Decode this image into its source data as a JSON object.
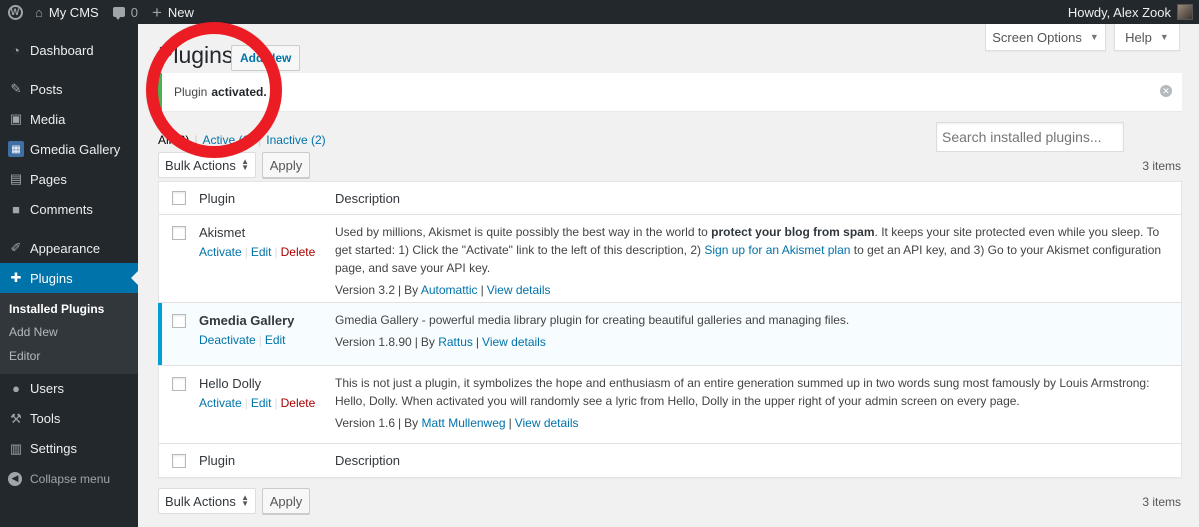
{
  "adminbar": {
    "site_name": "My CMS",
    "comment_count": "0",
    "new_label": "New",
    "greeting": "Howdy, Alex Zook"
  },
  "sidebar": {
    "items": [
      {
        "label": "Dashboard",
        "icon": "dashboard-icon"
      },
      {
        "label": "Posts",
        "icon": "pin-icon"
      },
      {
        "label": "Media",
        "icon": "media-icon"
      },
      {
        "label": "Gmedia Gallery",
        "icon": "gallery-icon"
      },
      {
        "label": "Pages",
        "icon": "pages-icon"
      },
      {
        "label": "Comments",
        "icon": "comment-icon"
      },
      {
        "label": "Appearance",
        "icon": "brush-icon"
      },
      {
        "label": "Plugins",
        "icon": "plugin-icon"
      },
      {
        "label": "Users",
        "icon": "users-icon"
      },
      {
        "label": "Tools",
        "icon": "wrench-icon"
      },
      {
        "label": "Settings",
        "icon": "settings-icon"
      }
    ],
    "submenu": [
      "Installed Plugins",
      "Add New",
      "Editor"
    ],
    "collapse_label": "Collapse menu"
  },
  "screen_options": "Screen Options",
  "help": "Help",
  "page": {
    "title": "Plugins",
    "add_new": "Add New"
  },
  "notice": {
    "prefix": "Plugin",
    "strong": "activated."
  },
  "views": {
    "all": "All (3)",
    "active": "Active (1)",
    "inactive": "Inactive (2)",
    "sep": "|"
  },
  "search": {
    "placeholder": "Search installed plugins..."
  },
  "tablenav": {
    "bulk_actions": "Bulk Actions",
    "apply": "Apply",
    "items": "3 items"
  },
  "table": {
    "col_plugin": "Plugin",
    "col_description": "Description",
    "plugins": [
      {
        "name": "Akismet",
        "actions": [
          "Activate",
          "Edit",
          "Delete"
        ],
        "desc_1": "Used by millions, Akismet is quite possibly the best way in the world to ",
        "desc_strong": "protect your blog from spam",
        "desc_2": ". It keeps your site protected even while you sleep. To get started: 1) Click the \"Activate\" link to the left of this description, 2) ",
        "desc_link": "Sign up for an Akismet plan",
        "desc_3": " to get an API key, and 3) Go to your Akismet configuration page, and save your API key.",
        "version": "Version 3.2",
        "by": "By",
        "author": "Automattic",
        "details": "View details"
      },
      {
        "name": "Gmedia Gallery",
        "actions": [
          "Deactivate",
          "Edit"
        ],
        "desc": "Gmedia Gallery - powerful media library plugin for creating beautiful galleries and managing files.",
        "version": "Version 1.8.90",
        "by": "By",
        "author": "Rattus",
        "details": "View details"
      },
      {
        "name": "Hello Dolly",
        "actions": [
          "Activate",
          "Edit",
          "Delete"
        ],
        "desc": "This is not just a plugin, it symbolizes the hope and enthusiasm of an entire generation summed up in two words sung most famously by Louis Armstrong: Hello, Dolly. When activated you will randomly see a lyric from Hello, Dolly in the upper right of your admin screen on every page.",
        "version": "Version 1.6",
        "by": "By",
        "author": "Matt Mullenweg",
        "details": "View details"
      }
    ]
  },
  "colors": {
    "admin_dark": "#23282d",
    "accent_blue": "#0073aa",
    "notice_green": "#46b450",
    "delete_red": "#a00",
    "annotation_red": "#ec1c24"
  }
}
